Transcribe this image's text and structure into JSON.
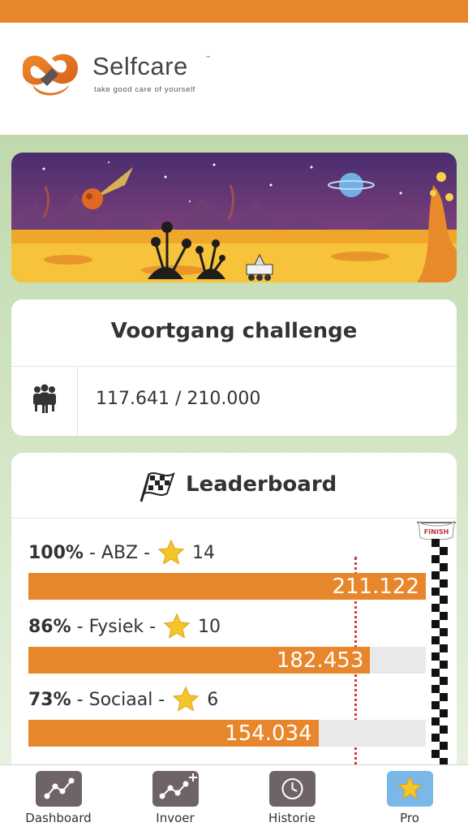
{
  "brand": {
    "name": "Selfcare",
    "trademark": "™",
    "tagline": "take good care of yourself"
  },
  "progress": {
    "title": "Voortgang challenge",
    "icon": "group-icon",
    "value": "117.641 / 210.000"
  },
  "leaderboard": {
    "title": "Leaderboard",
    "icon": "checkered-flag-icon",
    "finish_label": "FINISH",
    "rows": [
      {
        "percent": "100%",
        "name": "- ABZ -",
        "stars": "14",
        "value": "211.122",
        "fill": 1.0
      },
      {
        "percent": "86%",
        "name": "- Fysiek -",
        "stars": "10",
        "value": "182.453",
        "fill": 0.86
      },
      {
        "percent": "73%",
        "name": "- Sociaal -",
        "stars": "6",
        "value": "154.034",
        "fill": 0.73
      }
    ]
  },
  "tabs": [
    {
      "label": "Dashboard",
      "icon": "chart-icon",
      "active": false
    },
    {
      "label": "Invoer",
      "icon": "add-chart-icon",
      "active": false
    },
    {
      "label": "Historie",
      "icon": "clock-icon",
      "active": false
    },
    {
      "label": "Pro",
      "icon": "star-icon",
      "active": true
    }
  ],
  "colors": {
    "accent": "#e8862c",
    "bar_track": "#e9e9ec",
    "target_line": "#d8333d",
    "tab_icon_bg": "#6e6468",
    "tab_active_bg": "#7ab8e8"
  }
}
